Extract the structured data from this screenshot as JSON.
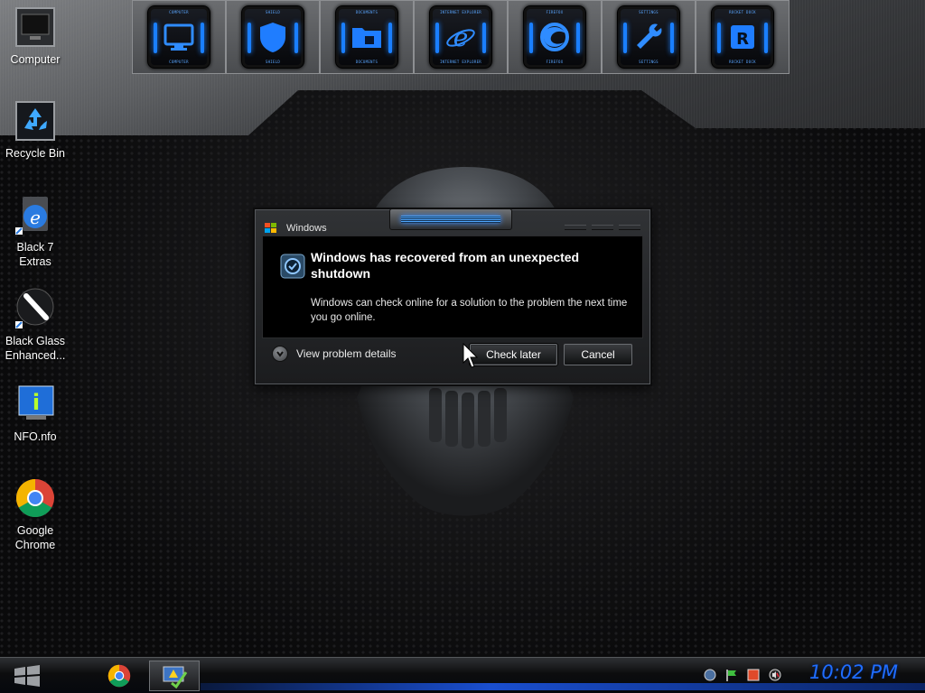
{
  "dock": {
    "items": [
      {
        "caption": "COMPUTER",
        "icon": "monitor-icon"
      },
      {
        "caption": "SHIELD",
        "icon": "shield-icon"
      },
      {
        "caption": "DOCUMENTS",
        "icon": "folder-icon"
      },
      {
        "caption": "INTERNET EXPLORER",
        "icon": "ie-icon"
      },
      {
        "caption": "FIREFOX",
        "icon": "firefox-icon"
      },
      {
        "caption": "SETTINGS",
        "icon": "wrench-icon"
      },
      {
        "caption": "ROCKET DOCK",
        "icon": "rocketdock-icon"
      }
    ]
  },
  "desktop": {
    "icons": [
      {
        "label": "Computer",
        "icon": "computer-icon"
      },
      {
        "label": "Recycle Bin",
        "icon": "recycle-bin-icon"
      },
      {
        "label": "Black 7 Extras",
        "icon": "ie-shortcut-icon"
      },
      {
        "label": "Black Glass Enhanced...",
        "icon": "brush-icon"
      },
      {
        "label": "NFO.nfo",
        "icon": "info-icon"
      },
      {
        "label": "Google Chrome",
        "icon": "chrome-icon"
      }
    ]
  },
  "dialog": {
    "title": "Windows",
    "heading": "Windows has recovered from an unexpected shutdown",
    "body": "Windows can check online for a solution to the problem the next time you go online.",
    "details_label": "View problem details",
    "check_later_label": "Check later",
    "cancel_label": "Cancel"
  },
  "taskbar": {
    "clock": "10:02 PM",
    "accent": "#1f6dff"
  }
}
